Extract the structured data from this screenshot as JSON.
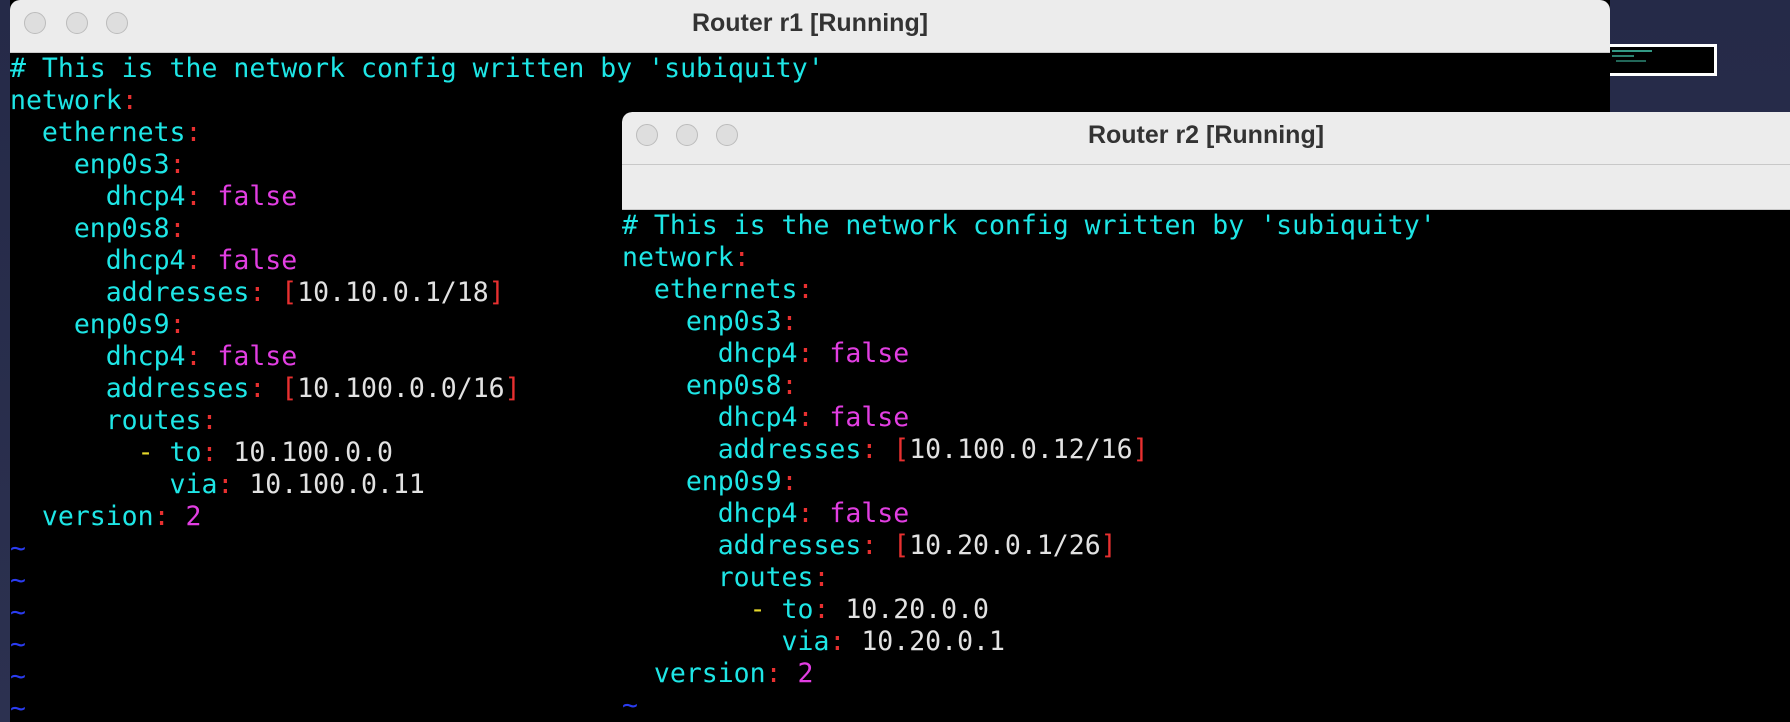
{
  "windows": [
    {
      "title": "Router r1 [Running]",
      "lines": [
        [
          {
            "t": "# This is the network config written by 'subiquity'",
            "c": "c"
          }
        ],
        [
          {
            "t": "network",
            "c": "c"
          },
          {
            "t": ":",
            "c": "r"
          }
        ],
        [
          {
            "t": "  ethernets",
            "c": "c"
          },
          {
            "t": ":",
            "c": "r"
          }
        ],
        [
          {
            "t": "    enp0s3",
            "c": "c"
          },
          {
            "t": ":",
            "c": "r"
          }
        ],
        [
          {
            "t": "      dhcp4",
            "c": "c"
          },
          {
            "t": ": ",
            "c": "r"
          },
          {
            "t": "false",
            "c": "m"
          }
        ],
        [
          {
            "t": "    enp0s8",
            "c": "c"
          },
          {
            "t": ":",
            "c": "r"
          }
        ],
        [
          {
            "t": "      dhcp4",
            "c": "c"
          },
          {
            "t": ": ",
            "c": "r"
          },
          {
            "t": "false",
            "c": "m"
          }
        ],
        [
          {
            "t": "      addresses",
            "c": "c"
          },
          {
            "t": ": [",
            "c": "r"
          },
          {
            "t": "10.10.0.1/18",
            "c": "w"
          },
          {
            "t": "]",
            "c": "r"
          }
        ],
        [
          {
            "t": "    enp0s9",
            "c": "c"
          },
          {
            "t": ":",
            "c": "r"
          }
        ],
        [
          {
            "t": "      dhcp4",
            "c": "c"
          },
          {
            "t": ": ",
            "c": "r"
          },
          {
            "t": "false",
            "c": "m"
          }
        ],
        [
          {
            "t": "      addresses",
            "c": "c"
          },
          {
            "t": ": [",
            "c": "r"
          },
          {
            "t": "10.100.0.0/16",
            "c": "w"
          },
          {
            "t": "]",
            "c": "r"
          }
        ],
        [
          {
            "t": "      routes",
            "c": "c"
          },
          {
            "t": ":",
            "c": "r"
          }
        ],
        [
          {
            "t": "        - ",
            "c": "y"
          },
          {
            "t": "to",
            "c": "c"
          },
          {
            "t": ": ",
            "c": "r"
          },
          {
            "t": "10.100.0.0",
            "c": "w"
          }
        ],
        [
          {
            "t": "          via",
            "c": "c"
          },
          {
            "t": ": ",
            "c": "r"
          },
          {
            "t": "10.100.0.11",
            "c": "w"
          }
        ],
        [
          {
            "t": "  version",
            "c": "c"
          },
          {
            "t": ": ",
            "c": "r"
          },
          {
            "t": "2",
            "c": "m"
          }
        ],
        [
          {
            "t": "~",
            "c": "t"
          }
        ],
        [
          {
            "t": "~",
            "c": "t"
          }
        ],
        [
          {
            "t": "~",
            "c": "t"
          }
        ],
        [
          {
            "t": "~",
            "c": "t"
          }
        ],
        [
          {
            "t": "~",
            "c": "t"
          }
        ],
        [
          {
            "t": "~",
            "c": "t"
          }
        ]
      ]
    },
    {
      "title": "Router r2 [Running]",
      "lines": [
        [
          {
            "t": "# This is the network config written by 'subiquity'",
            "c": "c"
          }
        ],
        [
          {
            "t": "network",
            "c": "c"
          },
          {
            "t": ":",
            "c": "r"
          }
        ],
        [
          {
            "t": "  ethernets",
            "c": "c"
          },
          {
            "t": ":",
            "c": "r"
          }
        ],
        [
          {
            "t": "    enp0s3",
            "c": "c"
          },
          {
            "t": ":",
            "c": "r"
          }
        ],
        [
          {
            "t": "      dhcp4",
            "c": "c"
          },
          {
            "t": ": ",
            "c": "r"
          },
          {
            "t": "false",
            "c": "m"
          }
        ],
        [
          {
            "t": "    enp0s8",
            "c": "c"
          },
          {
            "t": ":",
            "c": "r"
          }
        ],
        [
          {
            "t": "      dhcp4",
            "c": "c"
          },
          {
            "t": ": ",
            "c": "r"
          },
          {
            "t": "false",
            "c": "m"
          }
        ],
        [
          {
            "t": "      addresses",
            "c": "c"
          },
          {
            "t": ": [",
            "c": "r"
          },
          {
            "t": "10.100.0.12/16",
            "c": "w"
          },
          {
            "t": "]",
            "c": "r"
          }
        ],
        [
          {
            "t": "    enp0s9",
            "c": "c"
          },
          {
            "t": ":",
            "c": "r"
          }
        ],
        [
          {
            "t": "      dhcp4",
            "c": "c"
          },
          {
            "t": ": ",
            "c": "r"
          },
          {
            "t": "false",
            "c": "m"
          }
        ],
        [
          {
            "t": "      addresses",
            "c": "c"
          },
          {
            "t": ": [",
            "c": "r"
          },
          {
            "t": "10.20.0.1/26",
            "c": "w"
          },
          {
            "t": "]",
            "c": "r"
          }
        ],
        [
          {
            "t": "      routes",
            "c": "c"
          },
          {
            "t": ":",
            "c": "r"
          }
        ],
        [
          {
            "t": "        - ",
            "c": "y"
          },
          {
            "t": "to",
            "c": "c"
          },
          {
            "t": ": ",
            "c": "r"
          },
          {
            "t": "10.20.0.0",
            "c": "w"
          }
        ],
        [
          {
            "t": "          via",
            "c": "c"
          },
          {
            "t": ": ",
            "c": "r"
          },
          {
            "t": "10.20.0.1",
            "c": "w"
          }
        ],
        [
          {
            "t": "  version",
            "c": "c"
          },
          {
            "t": ": ",
            "c": "r"
          },
          {
            "t": "2",
            "c": "m"
          }
        ],
        [
          {
            "t": "~",
            "c": "t"
          }
        ]
      ]
    }
  ],
  "colors": {
    "cyan_keys": "#1ee6e6",
    "magenta_values": "#e23ee2",
    "red_punct": "#e83030",
    "white_values": "#e2e2e2",
    "yellow_dash": "#e6d82a",
    "blue_tilde": "#2a3cf0",
    "titlebar_bg": "#ececec"
  }
}
